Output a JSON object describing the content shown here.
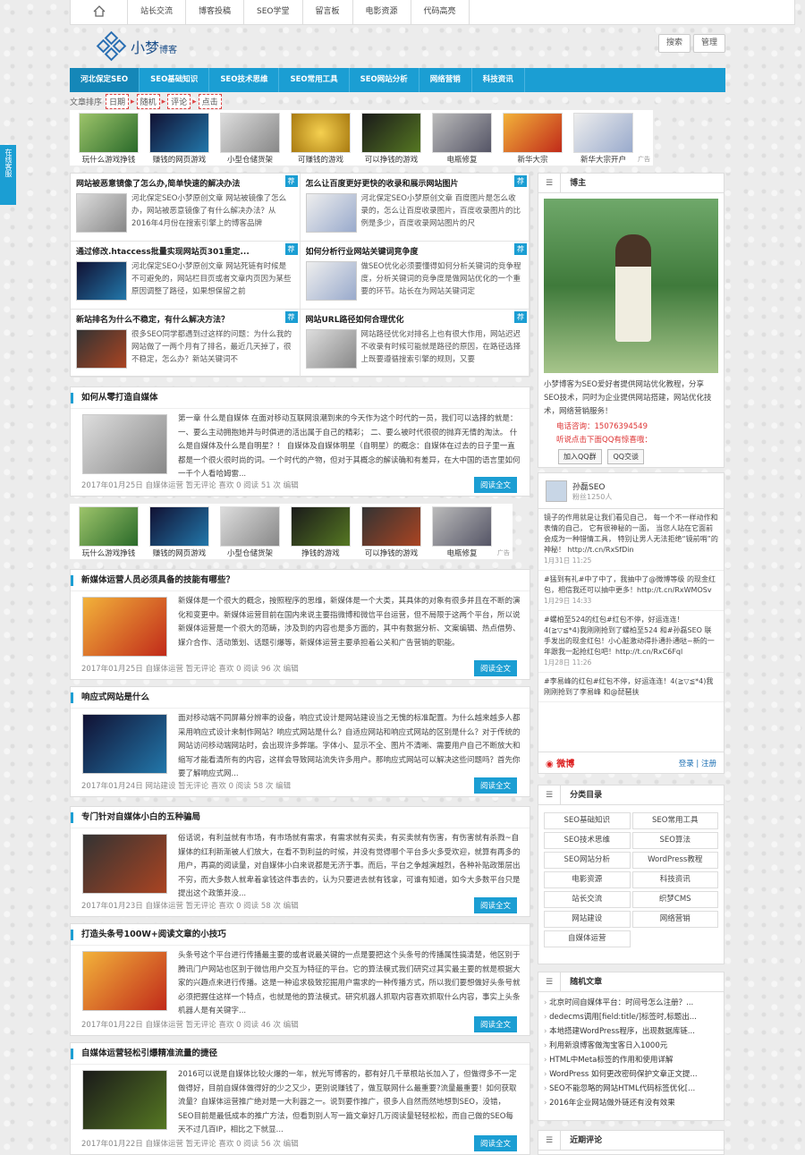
{
  "topnav": {
    "home_icon": "home-icon",
    "items": [
      "站长交流",
      "博客投稿",
      "SEO学堂",
      "留言板",
      "电影资源",
      "代码高亮"
    ]
  },
  "logo": {
    "text": "小梦",
    "suffix": "博客"
  },
  "header_buttons": {
    "search": "搜索",
    "admin": "管理"
  },
  "mainnav": [
    "河北保定SEO",
    "SEO基础知识",
    "SEO技术思维",
    "SEO常用工具",
    "SEO网站分析",
    "网络营销",
    "科技资讯"
  ],
  "sortbar": {
    "label": "文章排序",
    "items": [
      "日期",
      "随机",
      "评论",
      "点击"
    ]
  },
  "thumbs1": [
    "玩什么游戏挣钱",
    "赚钱的网页游戏",
    "小型仓储货架",
    "可赚钱的游戏",
    "可以挣钱的游戏",
    "电瓶修复",
    "新华大宗",
    "新华大宗开户"
  ],
  "ad_label": "广告",
  "grid_tag": "荐",
  "grid": [
    {
      "title": "网站被恶意镜像了怎么办,简单快速的解决办法",
      "text": "河北保定SEO小梦原创文章 网站被镜像了怎么办，网站被恶意镜像了有什么解决办法？从2016年4月份在搜索引擎上的博客品牌"
    },
    {
      "title": "怎么让百度更好更快的收录和展示网站图片",
      "text": "河北保定SEO小梦原创文章 百度图片是怎么收录的，怎么让百度收录图片，百度收录图片的比例是多少，百度收录网站图片的尺"
    },
    {
      "title": "通过修改.htaccess批量实现网站页301重定...",
      "text": "河北保定SEO小梦原创文章 网站死链有时候是不可避免的，网站栏目页或者文章内页因为某些原因调整了路径，如果想保留之前"
    },
    {
      "title": "如何分析行业网站关键词竞争度",
      "text": "做SEO优化必须要懂得如何分析关键词的竞争程度，分析关键词的竞争度是做网站优化的一个重要的环节。站长在为网站关键词定"
    },
    {
      "title": "新站排名为什么不稳定，有什么解决方法？",
      "text": "很多SEO同学都遇到过这样的问题：为什么我的网站做了一两个月有了排名，最近几天掉了，很不稳定，怎么办？新站关键词不"
    },
    {
      "title": "网站URL路径如何合理优化",
      "text": "网站路径优化对排名上也有很大作用，网站迟迟不收录有时候可能就是路径的原因，在路径选择上既要遵循搜索引擎的规则，又要"
    }
  ],
  "post_more": "阅读全文",
  "posts": [
    {
      "title": "如何从零打造自媒体",
      "text": "第一章 什么是自媒体 在面对移动互联网浪潮到来的今天作为这个时代的一员，我们可以选择的就是： 一、要么主动拥抱她并与时俱进的活出属于自己的精彩； 二、要么被时代很很的抛弃无情的淘汰。 什么是自媒体及什么是自明星？！ 自媒体及自媒体明星（自明星）的概念：自媒体在过去的日子里一直都是一个很火很时尚的词。一个时代的产物，但对于其概念的解读确和有差异，在大中国的语言里如何一千个人看哈姆雷...",
      "meta": "2017年01月25日 自媒体运营 暂无评论 喜欢 0 阅读 51 次 编辑"
    },
    {
      "title": "新媒体运营人员必须具备的技能有哪些？",
      "text": "新媒体是一个很大的概念，按照程序的思维，新媒体是一个大类，其具体的对象有很多并且在不断的演化和变更中。新媒体运营目前在国内来说主要指微博和微信平台运营，但不局限于这两个平台，所以说新媒体运营是一个很大的范畴，涉及到的内容也是多方面的，其中有数据分析、文案编辑、热点借势、媒介合作、活动策划、话题引爆等，新媒体运营主要承担着公关和广告营销的职能。",
      "meta": "2017年01月25日 自媒体运营 暂无评论 喜欢 0 阅读 96 次 编辑"
    },
    {
      "title": "响应式网站是什么",
      "text": "面对移动端不同屏幕分辨率的设备，响应式设计是网站建设当之无愧的标准配置。为什么越来越多人都采用响应式设计来制作网站？响应式网站是什么？自适应网站和响应式网站的区别是什么？对于传统的网站访问移动端网站时，会出现许多弊端。字体小、显示不全、图片不清晰、需要用户自己不断放大和缩写才能看清所有的内容，这样会导致网站流失许多用户。那响应式网站可以解决这些问题吗？首先你要了解响应式网...",
      "meta": "2017年01月24日 网站建设 暂无评论 喜欢 0 阅读 58 次 编辑"
    },
    {
      "title": "专门针对自媒体小白的五种骗局",
      "text": "俗话说，有利益就有市场，有市场就有需求，有需求就有买卖，有买卖就有伤害，有伤害就有杀戮~自媒体的红利新渐被人们放大，在看不到利益的时候，并没有觉得哪个平台多火多受欢迎，就算有再多的用户，再高的阅读量，对自媒体小白来说都是无济于事。而后，平台之争越演越烈，各种补贴政策层出不穷，而大多数人就卑着拿钱这件事去的，认为只要进去就有钱拿，可谁有知道，如今大多数平台只是提出这个政策并没...",
      "meta": "2017年01月23日 自媒体运营 暂无评论 喜欢 0 阅读 58 次 编辑"
    },
    {
      "title": "打造头条号100W+阅读文章的小技巧",
      "text": "头条号这个平台进行传播最主要的或者说最关键的一点是要把这个头条号的传播属性搞清楚，他区别于腾讯门户网站也区别于微信用户交互为特征的平台。它的算法模式我们研究过其实最主要的就是根据大家的兴趣点来进行传播。这是一种追求极致挖掘用户需求的一种传播方式，所以我们要想做好头条号就必须把握住这样一个特点，也就是他的算法模式。研究机器人抓取内容喜欢抓取什么内容，事实上头条机器人是有关键字...",
      "meta": "2017年01月22日 自媒体运营 暂无评论 喜欢 0 阅读 46 次 编辑"
    },
    {
      "title": "自媒体运营轻松引爆精准流量的捷径",
      "text": "2016可以说是自媒体比较火爆的一年，就光写博客的，都有好几千草根站长加入了，但做得多不一定做得好，目前自媒体做得好的少之又少，更别说赚钱了，做互联网什么最重要?流量最重要！如何获取流量？自媒体运营推广绝对是一大利器之一。说到要作推广，很多人自然而然地想到SEO，没错，SEO目前是最低成本的推广方法，但看到别人写一篇文章好几万阅读量轻轻松松，而自己做的SEO每天不过几百IP，相比之下就显...",
      "meta": "2017年01月22日 自媒体运营 暂无评论 喜欢 0 阅读 56 次 编辑"
    }
  ],
  "thumbs2": [
    "玩什么游戏挣钱",
    "赚钱的网页游戏",
    "小型仓储货架",
    "挣钱的游戏",
    "可以挣钱的游戏",
    "电瓶修复"
  ],
  "blogger": {
    "title": "博主",
    "bio": "小梦博客为SEO爱好者提供网站优化教程，分享SEO技术，同时为企业提供网站搭建，网站优化技术，网络营销服务！",
    "phone": "电话咨询：15076394549",
    "qq_note": "听说点击下面QQ有惊喜哦：",
    "qq_join": "加入QQ群",
    "qq_chat": "QQ交谈"
  },
  "weibo": {
    "name": "孙磊SEO",
    "fans": "粉丝1250人",
    "items": [
      {
        "text": "镜子的作用就是让我们看见自己， 每一个不一样动作和表情的自己， 它有很神秘的一面， 当您人站在它面前会成为一种错情工具， 特别让男人无法拒绝“镜前哨”的神秘！ http://t.cn/RxSfDin",
        "time": "1月31日 11:25"
      },
      {
        "text": "#猛到有礼#中了中了，我抽中了@微博等级 的现金红包，相信我还可以抽中更多！http://t.cn/RxWMOSv",
        "time": "1月29日 14:33"
      },
      {
        "text": "#螺柏至524的红包#红包不停，好运连连！4(≧▽≦*4)我刚刚抢到了螺柏至524 和#孙磊SEO 联手发出的现金红包！小心脏激动得扑通扑通哒~新的一年跟我一起抢红包吧！http://t.cn/RxC6Fql",
        "time": "1月28日 11:26"
      },
      {
        "text": "#李易峰的红包#红包不停，好运连连！4(≧▽≦*4)我刚刚抢到了李易峰 和@琵琶扶",
        "time": ""
      }
    ],
    "brand": "微博",
    "login": "登录",
    "register": "注册"
  },
  "categories": {
    "title": "分类目录",
    "items": [
      "SEO基础知识",
      "SEO常用工具",
      "SEO技术思维",
      "SEO算法",
      "SEO网站分析",
      "WordPress教程",
      "电影资源",
      "科技资讯",
      "站长交流",
      "织梦CMS",
      "网站建设",
      "网络营销",
      "自媒体运营"
    ]
  },
  "random": {
    "title": "随机文章",
    "items": [
      "北京时间自媒体平台：时间号怎么注册？...",
      "dedecms调用[field:title/]标签时,标题出...",
      "本地搭建WordPress程序，出现数据库链...",
      "利用新浪博客做淘宝客日入1000元",
      "HTML中Meta标签的作用和使用详解",
      "WordPress 如何更改密码保护文章正文提...",
      "SEO不能忽略的网站HTML代码标签优化[...",
      "2016年企业网站做外链还有没有效果"
    ]
  },
  "recent_comments": {
    "title": "近期评论"
  },
  "float_service": "在线客服"
}
